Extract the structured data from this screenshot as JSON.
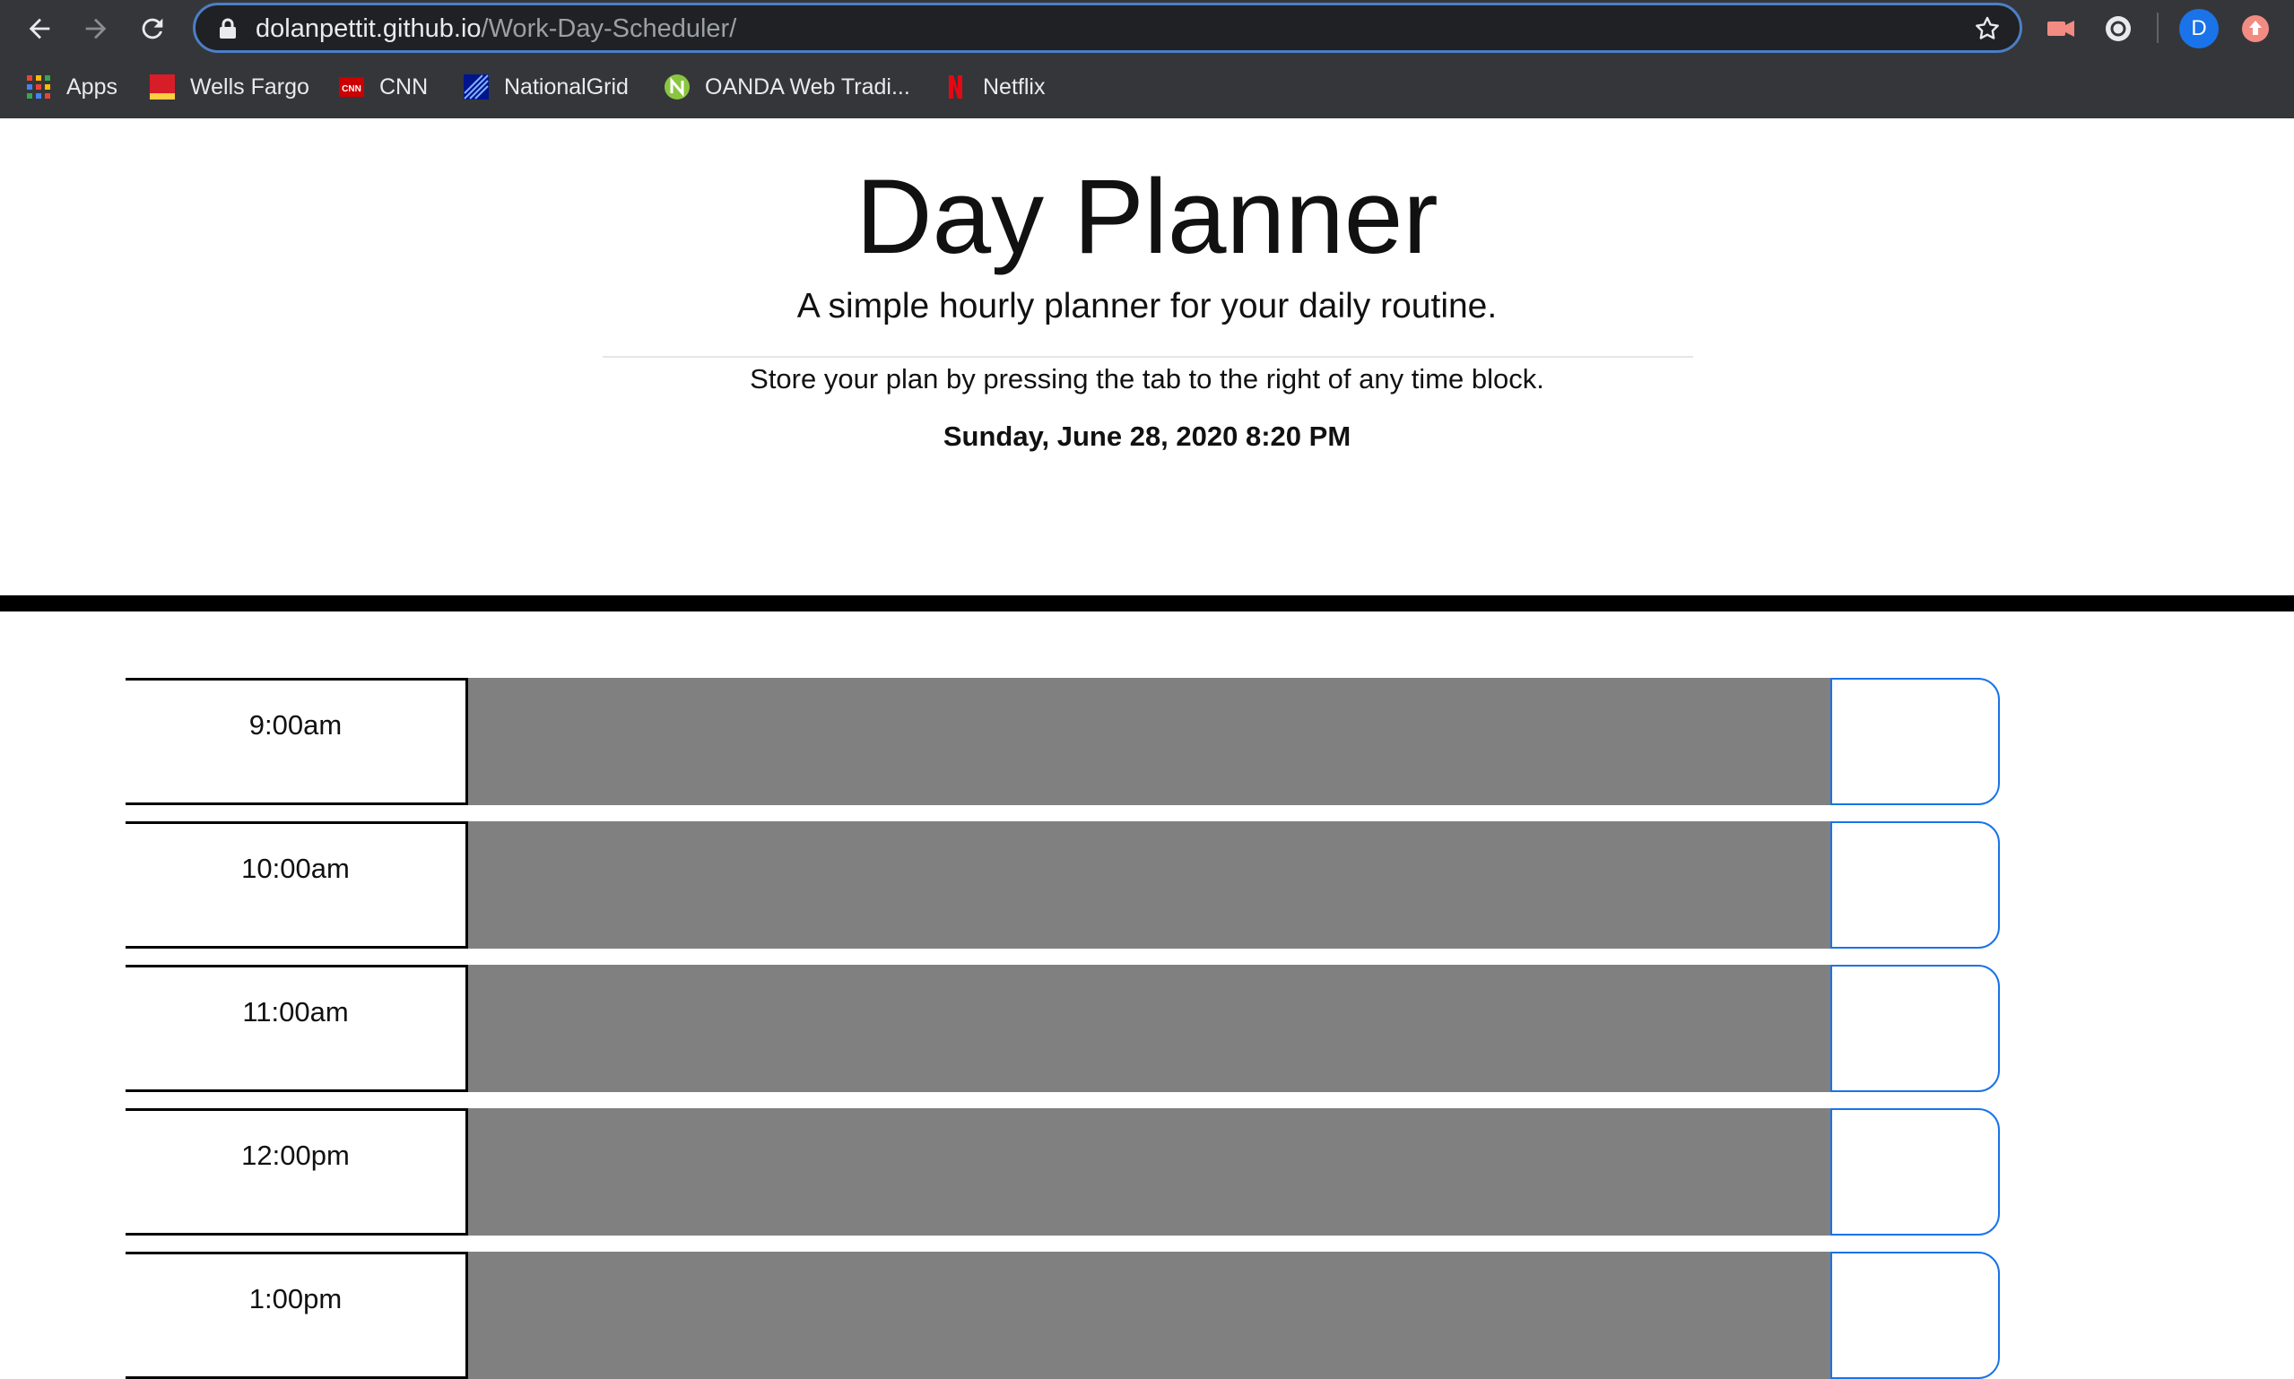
{
  "browser": {
    "url_host": "dolanpettit.github.io",
    "url_path": "/Work-Day-Scheduler/",
    "profile_initial": "D",
    "bookmarks": [
      {
        "label": "Apps",
        "icon": "apps-grid-icon"
      },
      {
        "label": "Wells Fargo",
        "icon": "wells-fargo-icon"
      },
      {
        "label": "CNN",
        "icon": "cnn-icon"
      },
      {
        "label": "NationalGrid",
        "icon": "nationalgrid-icon"
      },
      {
        "label": "OANDA Web Tradi...",
        "icon": "oanda-icon"
      },
      {
        "label": "Netflix",
        "icon": "netflix-icon"
      }
    ]
  },
  "header": {
    "title": "Day Planner",
    "lead": "A simple hourly planner for your daily routine.",
    "instructions": "Store your plan by pressing the tab to the right of any time block.",
    "current_day": "Sunday, June 28, 2020 8:20 PM"
  },
  "time_blocks": [
    {
      "hour": "9:00am",
      "description": ""
    },
    {
      "hour": "10:00am",
      "description": ""
    },
    {
      "hour": "11:00am",
      "description": ""
    },
    {
      "hour": "12:00pm",
      "description": ""
    },
    {
      "hour": "1:00pm",
      "description": ""
    }
  ],
  "colors": {
    "past_block": "#808080",
    "save_border": "#1a73e8",
    "chrome_bg": "#35363a"
  }
}
